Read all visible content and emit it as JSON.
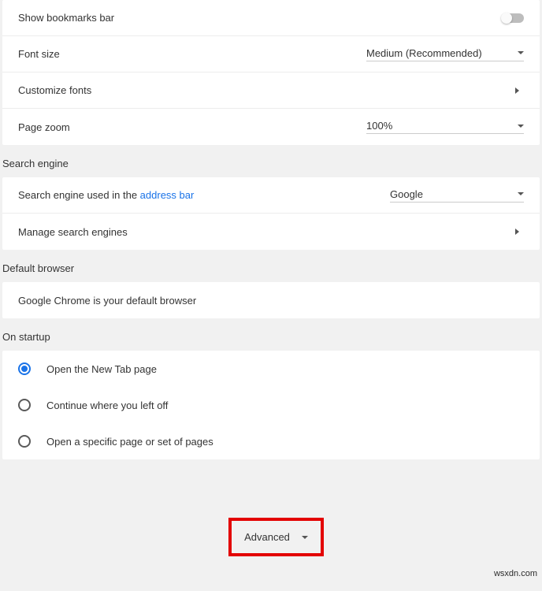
{
  "appearance": {
    "bookmarksLabel": "Show bookmarks bar",
    "fontSizeLabel": "Font size",
    "fontSizeValue": "Medium (Recommended)",
    "customizeFontsLabel": "Customize fonts",
    "pageZoomLabel": "Page zoom",
    "pageZoomValue": "100%"
  },
  "searchEngine": {
    "sectionTitle": "Search engine",
    "usedLabelPre": "Search engine used in the ",
    "usedLink": "address bar",
    "value": "Google",
    "manageLabel": "Manage search engines"
  },
  "defaultBrowser": {
    "sectionTitle": "Default browser",
    "text": "Google Chrome is your default browser"
  },
  "startup": {
    "sectionTitle": "On startup",
    "opt1": "Open the New Tab page",
    "opt2": "Continue where you left off",
    "opt3": "Open a specific page or set of pages"
  },
  "advanced": "Advanced",
  "watermark": "wsxdn.com"
}
